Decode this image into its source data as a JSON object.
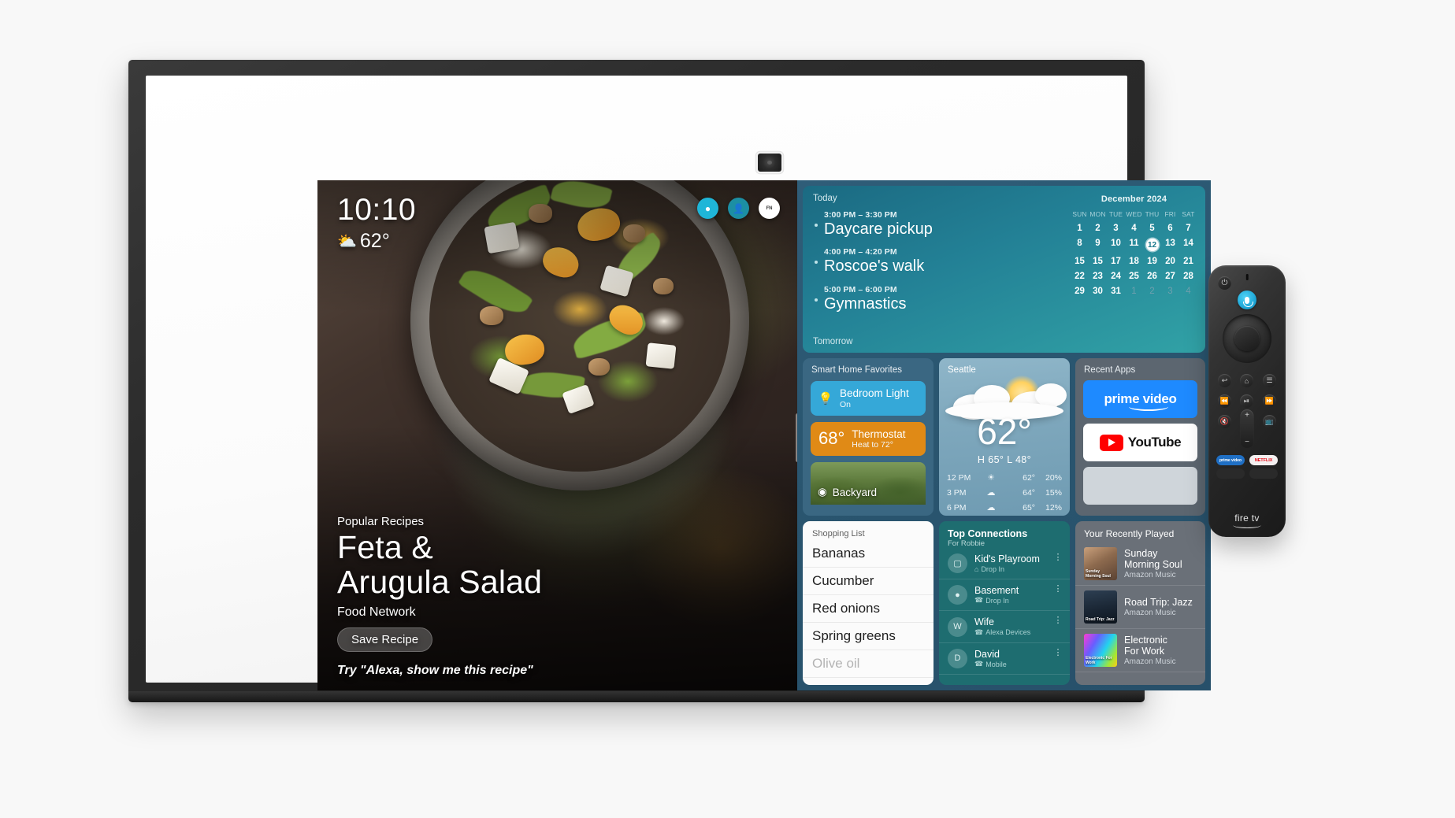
{
  "device": {
    "name": "Echo Show 15 smart display",
    "camera_icon": "camera-icon"
  },
  "screen": {
    "recipe": {
      "clock": "10:10",
      "weather_glyph": "⛅",
      "temperature": "62°",
      "kicker": "Popular Recipes",
      "title_line1": "Feta &",
      "title_line2": "Arugula Salad",
      "source": "Food Network",
      "save_button": "Save Recipe",
      "voice_hint": "Try \"Alexa, show me this recipe\"",
      "badges": [
        {
          "name": "notification-badge",
          "glyph": "●",
          "color": "#1fb6d8"
        },
        {
          "name": "profile-badge",
          "glyph": "●",
          "color": "#1c8fa4"
        },
        {
          "name": "food-network-badge",
          "glyph": "FN",
          "color": "#ffffff"
        }
      ]
    },
    "agenda": {
      "today_label": "Today",
      "tomorrow_label": "Tomorrow",
      "events": [
        {
          "time": "3:00 PM – 3:30 PM",
          "title": "Daycare pickup"
        },
        {
          "time": "4:00 PM – 4:20 PM",
          "title": "Roscoe's walk"
        },
        {
          "time": "5:00 PM – 6:00 PM",
          "title": "Gymnastics"
        }
      ]
    },
    "calendar": {
      "month": "December 2024",
      "dow": [
        "SUN",
        "MON",
        "TUE",
        "WED",
        "THU",
        "FRI",
        "SAT"
      ],
      "today": 12,
      "weeks": [
        [
          {
            "d": "1"
          },
          {
            "d": "2"
          },
          {
            "d": "3"
          },
          {
            "d": "4"
          },
          {
            "d": "5"
          },
          {
            "d": "6"
          },
          {
            "d": "7"
          }
        ],
        [
          {
            "d": "8"
          },
          {
            "d": "9"
          },
          {
            "d": "10"
          },
          {
            "d": "11"
          },
          {
            "d": "12",
            "today": true
          },
          {
            "d": "13"
          },
          {
            "d": "14"
          }
        ],
        [
          {
            "d": "15"
          },
          {
            "d": "15"
          },
          {
            "d": "17"
          },
          {
            "d": "18"
          },
          {
            "d": "19"
          },
          {
            "d": "20"
          },
          {
            "d": "21"
          }
        ],
        [
          {
            "d": "22"
          },
          {
            "d": "23"
          },
          {
            "d": "24"
          },
          {
            "d": "25"
          },
          {
            "d": "26"
          },
          {
            "d": "27"
          },
          {
            "d": "28"
          }
        ],
        [
          {
            "d": "29"
          },
          {
            "d": "30"
          },
          {
            "d": "31"
          },
          {
            "d": "1",
            "dim": true
          },
          {
            "d": "2",
            "dim": true
          },
          {
            "d": "3",
            "dim": true
          },
          {
            "d": "4",
            "dim": true
          }
        ]
      ]
    },
    "smart_home": {
      "header": "Smart Home Favorites",
      "light": {
        "icon": "lightbulb-icon",
        "name": "Bedroom Light",
        "state": "On",
        "color": "#35a8d8"
      },
      "thermostat": {
        "temp": "68°",
        "name": "Thermostat",
        "state": "Heat to 72°",
        "color": "#e08a16"
      },
      "camera": {
        "icon": "camera-icon",
        "name": "Backyard"
      }
    },
    "weather": {
      "city": "Seattle",
      "current": "62°",
      "high_low": "H 65°  L 48°",
      "hourly": [
        {
          "time": "12 PM",
          "icon": "sun-icon",
          "glyph": "☀",
          "temp": "62°",
          "precip": "20%"
        },
        {
          "time": "3 PM",
          "icon": "cloud-icon",
          "glyph": "☁",
          "temp": "64°",
          "precip": "15%"
        },
        {
          "time": "6 PM",
          "icon": "cloud-icon",
          "glyph": "☁",
          "temp": "65°",
          "precip": "12%"
        }
      ]
    },
    "recent_apps": {
      "header": "Recent Apps",
      "apps": [
        {
          "name": "prime-video-app",
          "label": "prime video"
        },
        {
          "name": "youtube-app",
          "label": "YouTube"
        }
      ]
    },
    "shopping_list": {
      "header": "Shopping List",
      "items": [
        {
          "text": "Bananas",
          "faded": false
        },
        {
          "text": "Cucumber",
          "faded": false
        },
        {
          "text": "Red onions",
          "faded": false
        },
        {
          "text": "Spring greens",
          "faded": false
        },
        {
          "text": "Olive oil",
          "faded": true
        }
      ]
    },
    "connections": {
      "header": "Top Connections",
      "subheader": "For Robbie",
      "items": [
        {
          "avatar_icon": "display-icon",
          "initial": "",
          "name": "Kid's Playroom",
          "sub": "Drop In",
          "sub_icon": "dropin-icon",
          "sub_glyph": "⌂"
        },
        {
          "avatar_icon": "echo-dot-icon",
          "initial": "",
          "name": "Basement",
          "sub": "Drop In",
          "sub_icon": "phone-icon",
          "sub_glyph": "☎"
        },
        {
          "avatar_icon": "",
          "initial": "W",
          "name": "Wife",
          "sub": "Alexa Devices",
          "sub_icon": "phone-icon",
          "sub_glyph": "☎"
        },
        {
          "avatar_icon": "",
          "initial": "D",
          "name": "David",
          "sub": "Mobile",
          "sub_icon": "phone-icon",
          "sub_glyph": "☎"
        }
      ],
      "overflow_glyph": "⋮"
    },
    "recently_played": {
      "header": "Your Recently Played",
      "items": [
        {
          "art": "art-soul",
          "caption": "Sunday Morning Soul",
          "title_line1": "Sunday",
          "title_line2": "Morning Soul",
          "service": "Amazon Music"
        },
        {
          "art": "art-jazz",
          "caption": "Road Trip: Jazz",
          "title_line1": "Road Trip: Jazz",
          "title_line2": "",
          "service": "Amazon Music"
        },
        {
          "art": "art-elec",
          "caption": "Electronic For Work",
          "title_line1": "Electronic",
          "title_line2": "For Work",
          "service": "Amazon Music"
        }
      ]
    }
  },
  "remote": {
    "name": "Fire TV Alexa Voice Remote",
    "brand": "fire tv",
    "power_glyph": "⏻",
    "buttons": [
      {
        "name": "back-button",
        "glyph": "↩"
      },
      {
        "name": "home-button",
        "glyph": "⌂"
      },
      {
        "name": "menu-button",
        "glyph": "☰"
      },
      {
        "name": "rewind-button",
        "glyph": "⏪"
      },
      {
        "name": "play-pause-button",
        "glyph": "⏯"
      },
      {
        "name": "fast-forward-button",
        "glyph": "⏩"
      },
      {
        "name": "mute-button",
        "glyph": "ὐ7"
      },
      {
        "name": "channel-guide-button",
        "glyph": "὏A"
      }
    ],
    "volume_up": "+",
    "volume_down": "−",
    "app_buttons": [
      {
        "name": "prime-video-shortcut",
        "label": "prime video"
      },
      {
        "name": "netflix-shortcut",
        "label": "NETFLIX"
      }
    ]
  }
}
